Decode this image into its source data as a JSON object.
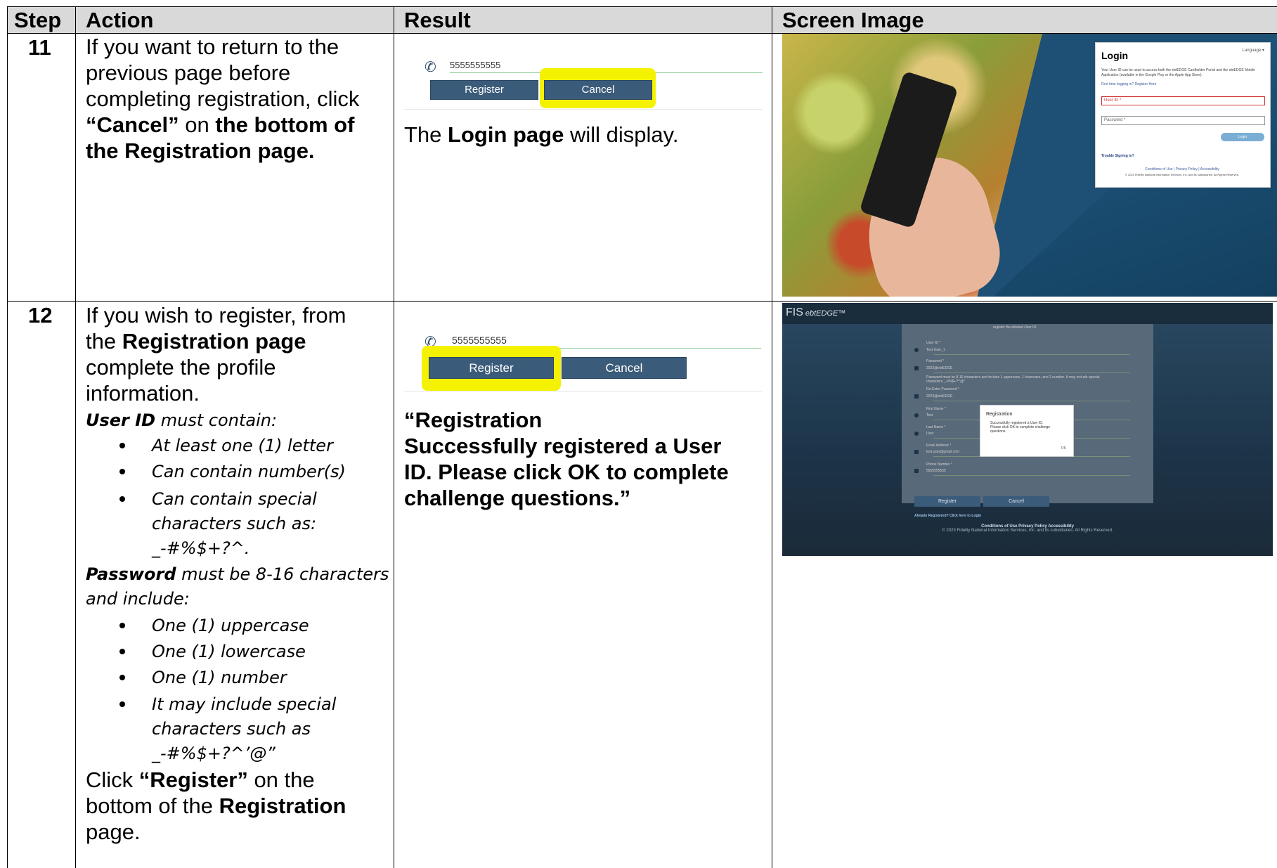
{
  "headers": {
    "step": "Step",
    "action": "Action",
    "result": "Result",
    "screen": "Screen Image"
  },
  "rows": [
    {
      "step": "11",
      "action": {
        "line1": "If you want to return to the",
        "line2": "previous page before",
        "line3": "completing registration, click",
        "cancel_quote": "“Cancel”",
        "on": " on ",
        "bottom_of": "the bottom of",
        "reg_page": "the Registration page."
      },
      "result": {
        "phone": "5555555555",
        "register_btn": "Register",
        "cancel_btn": "Cancel",
        "text_pre": "The ",
        "text_bold": "Login page",
        "text_post": " will display."
      },
      "screen": {
        "title": "Login",
        "language": "Language ▾",
        "intro": "Your User ID can be used to access both the ebtEDGE Cardholder Portal and the ebtEDGE Mobile Application (available in the Google Play or the Apple App Store).",
        "first_time": "First time logging in? Register Here",
        "user_id": "User ID *",
        "password": "Password *",
        "login_btn": "Login",
        "trouble": "Trouble Signing in?",
        "footer_links": "Conditions of Use  |  Privacy Policy  |  Accessibility",
        "footer_copy": "© 2023 Fidelity National Information Services, Inc. and its subsidiaries. All Rights Reserved."
      }
    },
    {
      "step": "12",
      "action": {
        "l1": "If you wish to register, from",
        "l2_pre": "the ",
        "l2_bold": "Registration page",
        "l3": "complete the profile",
        "l4": "information.",
        "uid_bold": "User ID",
        "uid_rest": " must contain:",
        "uid_bullets": [
          "At least one (1) letter",
          "Can contain number(s)",
          "Can contain special",
          "characters such as:",
          "_-#%$+?^."
        ],
        "pw_bold": "Password",
        "pw_rest": " must be 8-16 characters",
        "pw_rest2": "and include:",
        "pw_bullets": [
          "One (1) uppercase",
          "One (1) lowercase",
          "One (1) number",
          "It may include special",
          "characters such as",
          "_-#%$+?^’@”"
        ],
        "click": "Click ",
        "register_quote": "“Register”",
        "on_the": " on the",
        "bottom_of_the": "bottom of the ",
        "registration": "Registration",
        "page": "page."
      },
      "result": {
        "phone": "5555555555",
        "register_btn": "Register",
        "cancel_btn": "Cancel",
        "msg1": "“Registration",
        "msg2": "Successfully registered a User",
        "msg3": "ID.  Please click OK to complete",
        "msg4": "challenge questions.”"
      },
      "screen": {
        "logo": "FIS",
        "logo_sub": "ebtEDGE™",
        "top_msg": "register the deleted User ID.",
        "user_id_label": "User ID *",
        "user_id_val": "Test User_1",
        "pw_label": "Password *",
        "pw_val": "2023@ebtEDGE",
        "pw_hint": "Password must be 8-16 characters and include 1 uppercase, 1 lowercase, and 1 number. It may include special characters _-#%$+?^'@\"",
        "repw_label": "Re-Enter Password *",
        "repw_val": "2023@ebtEDGE",
        "first_label": "First Name *",
        "first_val": "Test",
        "last_label": "Last Name *",
        "last_val": "User",
        "email_label": "Email Address *",
        "email_val": "test.user@gmail.com",
        "phone_label": "Phone Number *",
        "phone_val": "5555555555",
        "dialog_title": "Registration",
        "dialog_msg": "Successfully registered a User ID. Please click OK to complete challenge questions.",
        "dialog_ok": "OK",
        "register_btn": "Register",
        "cancel_btn": "Cancel",
        "already": "Already Registered? Click here to Login",
        "footer_links": "Conditions of Use  Privacy Policy  Accessibility",
        "footer_copy": "© 2023 Fidelity National Information Services, Inc. and its subsidiaries. All Rights Reserved."
      }
    }
  ]
}
